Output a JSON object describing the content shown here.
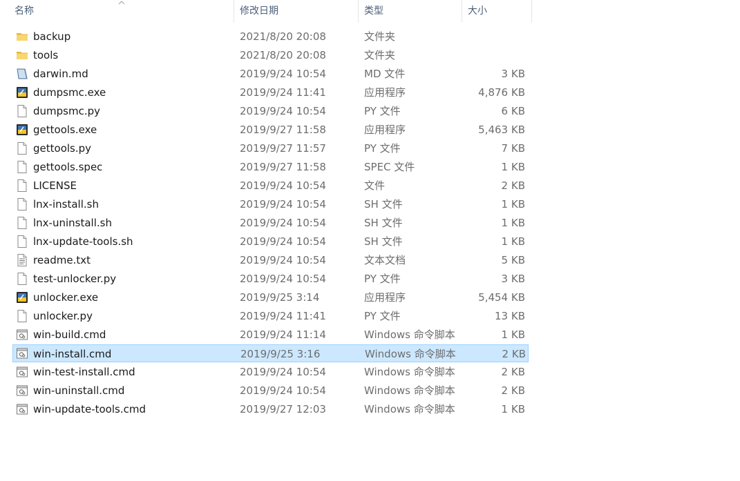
{
  "columns": {
    "name": "名称",
    "modified": "修改日期",
    "type": "类型",
    "size": "大小"
  },
  "selected_index": 17,
  "files": [
    {
      "name": "backup",
      "modified": "2021/8/20 20:08",
      "type": "文件夹",
      "size": "",
      "icon": "folder-icon"
    },
    {
      "name": "tools",
      "modified": "2021/8/20 20:08",
      "type": "文件夹",
      "size": "",
      "icon": "folder-icon"
    },
    {
      "name": "darwin.md",
      "modified": "2019/9/24 10:54",
      "type": "MD 文件",
      "size": "3 KB",
      "icon": "markdown-file-icon"
    },
    {
      "name": "dumpsmc.exe",
      "modified": "2019/9/24 11:41",
      "type": "应用程序",
      "size": "4,876 KB",
      "icon": "python-exe-icon"
    },
    {
      "name": "dumpsmc.py",
      "modified": "2019/9/24 10:54",
      "type": "PY 文件",
      "size": "6 KB",
      "icon": "blank-file-icon"
    },
    {
      "name": "gettools.exe",
      "modified": "2019/9/27 11:58",
      "type": "应用程序",
      "size": "5,463 KB",
      "icon": "python-exe-icon"
    },
    {
      "name": "gettools.py",
      "modified": "2019/9/27 11:57",
      "type": "PY 文件",
      "size": "7 KB",
      "icon": "blank-file-icon"
    },
    {
      "name": "gettools.spec",
      "modified": "2019/9/27 11:58",
      "type": "SPEC 文件",
      "size": "1 KB",
      "icon": "blank-file-icon"
    },
    {
      "name": "LICENSE",
      "modified": "2019/9/24 10:54",
      "type": "文件",
      "size": "2 KB",
      "icon": "blank-file-icon"
    },
    {
      "name": "lnx-install.sh",
      "modified": "2019/9/24 10:54",
      "type": "SH 文件",
      "size": "1 KB",
      "icon": "blank-file-icon"
    },
    {
      "name": "lnx-uninstall.sh",
      "modified": "2019/9/24 10:54",
      "type": "SH 文件",
      "size": "1 KB",
      "icon": "blank-file-icon"
    },
    {
      "name": "lnx-update-tools.sh",
      "modified": "2019/9/24 10:54",
      "type": "SH 文件",
      "size": "1 KB",
      "icon": "blank-file-icon"
    },
    {
      "name": "readme.txt",
      "modified": "2019/9/24 10:54",
      "type": "文本文档",
      "size": "5 KB",
      "icon": "text-file-icon"
    },
    {
      "name": "test-unlocker.py",
      "modified": "2019/9/24 10:54",
      "type": "PY 文件",
      "size": "3 KB",
      "icon": "blank-file-icon"
    },
    {
      "name": "unlocker.exe",
      "modified": "2019/9/25 3:14",
      "type": "应用程序",
      "size": "5,454 KB",
      "icon": "python-exe-icon"
    },
    {
      "name": "unlocker.py",
      "modified": "2019/9/24 11:41",
      "type": "PY 文件",
      "size": "13 KB",
      "icon": "blank-file-icon"
    },
    {
      "name": "win-build.cmd",
      "modified": "2019/9/24 11:14",
      "type": "Windows 命令脚本",
      "size": "1 KB",
      "icon": "cmd-script-icon"
    },
    {
      "name": "win-install.cmd",
      "modified": "2019/9/25 3:16",
      "type": "Windows 命令脚本",
      "size": "2 KB",
      "icon": "cmd-script-icon"
    },
    {
      "name": "win-test-install.cmd",
      "modified": "2019/9/24 10:54",
      "type": "Windows 命令脚本",
      "size": "2 KB",
      "icon": "cmd-script-icon"
    },
    {
      "name": "win-uninstall.cmd",
      "modified": "2019/9/24 10:54",
      "type": "Windows 命令脚本",
      "size": "2 KB",
      "icon": "cmd-script-icon"
    },
    {
      "name": "win-update-tools.cmd",
      "modified": "2019/9/27 12:03",
      "type": "Windows 命令脚本",
      "size": "1 KB",
      "icon": "cmd-script-icon"
    }
  ]
}
